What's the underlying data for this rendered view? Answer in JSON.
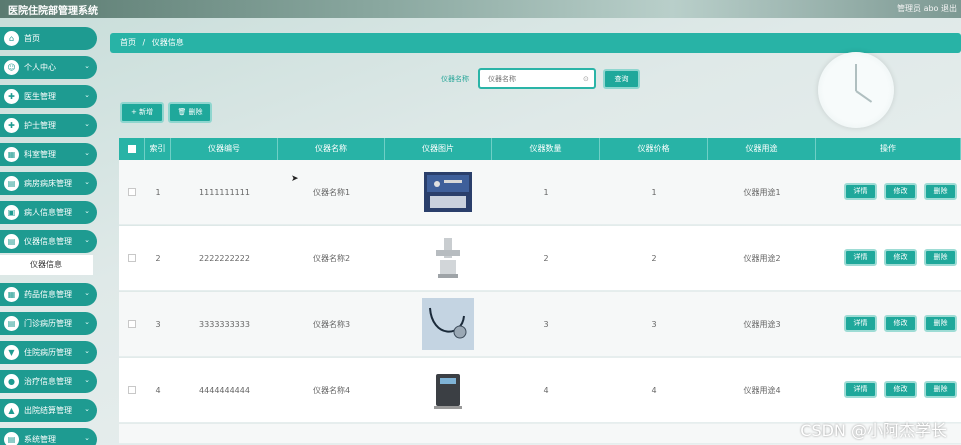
{
  "app": {
    "title": "医院住院部管理系统",
    "user_info": "管理员 abo   退出"
  },
  "sidebar": {
    "items": [
      {
        "label": "首页",
        "icon": "home-icon",
        "has_chevron": false
      },
      {
        "label": "个人中心",
        "icon": "user-icon",
        "has_chevron": true
      },
      {
        "label": "医生管理",
        "icon": "doctor-icon",
        "has_chevron": true
      },
      {
        "label": "护士管理",
        "icon": "nurse-icon",
        "has_chevron": true
      },
      {
        "label": "科室管理",
        "icon": "dept-icon",
        "has_chevron": true
      },
      {
        "label": "病房病床管理",
        "icon": "bed-icon",
        "has_chevron": true
      },
      {
        "label": "病人信息管理",
        "icon": "patient-icon",
        "has_chevron": true
      },
      {
        "label": "仪器信息管理",
        "icon": "instrument-icon",
        "has_chevron": true
      },
      {
        "label": "药品信息管理",
        "icon": "medicine-icon",
        "has_chevron": true
      },
      {
        "label": "门诊病历管理",
        "icon": "record-icon",
        "has_chevron": true
      },
      {
        "label": "住院病历管理",
        "icon": "inpatient-icon",
        "has_chevron": true
      },
      {
        "label": "治疗信息管理",
        "icon": "treatment-icon",
        "has_chevron": true
      },
      {
        "label": "出院结算管理",
        "icon": "checkout-icon",
        "has_chevron": true
      },
      {
        "label": "系统管理",
        "icon": "system-icon",
        "has_chevron": true
      }
    ],
    "submenu_active": "仪器信息"
  },
  "breadcrumb": {
    "home": "首页",
    "separator": "/",
    "current": "仪器信息"
  },
  "search": {
    "label": "仪器名称",
    "placeholder": "仪器名称",
    "button": "查询"
  },
  "toolbar": {
    "add": "+ 新增",
    "delete": "删除"
  },
  "table": {
    "headers": [
      "",
      "索引",
      "仪器编号",
      "仪器名称",
      "仪器图片",
      "仪器数量",
      "仪器价格",
      "仪器用途",
      "操作"
    ],
    "rows": [
      {
        "index": "1",
        "code": "1111111111",
        "name": "仪器名称1",
        "image": "toolkit-image",
        "qty": "1",
        "price": "1",
        "usage": "仪器用途1"
      },
      {
        "index": "2",
        "code": "2222222222",
        "name": "仪器名称2",
        "image": "faucet-image",
        "qty": "2",
        "price": "2",
        "usage": "仪器用途2"
      },
      {
        "index": "3",
        "code": "3333333333",
        "name": "仪器名称3",
        "image": "stethoscope-image",
        "qty": "3",
        "price": "3",
        "usage": "仪器用途3"
      },
      {
        "index": "4",
        "code": "4444444444",
        "name": "仪器名称4",
        "image": "device-image",
        "qty": "4",
        "price": "4",
        "usage": "仪器用途4"
      }
    ],
    "actions": {
      "detail": "详情",
      "edit": "修改",
      "delete": "删除"
    }
  },
  "watermark": "CSDN @小阿杰学长",
  "colors": {
    "primary": "#1fa89b",
    "header": "#28b3a6"
  }
}
